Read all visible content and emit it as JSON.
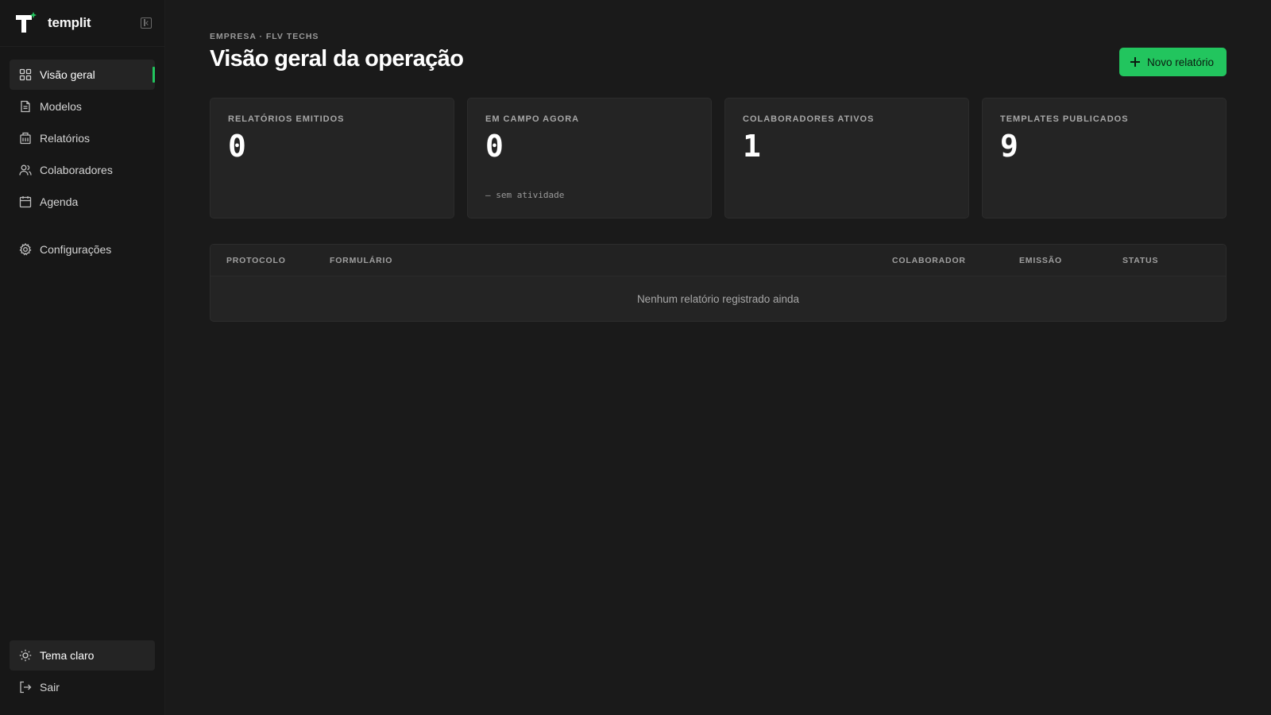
{
  "app": {
    "name": "templit"
  },
  "colors": {
    "accent": "#22c55e",
    "background": "#1a1a1a",
    "sidebar": "#171717",
    "card": "#242424"
  },
  "sidebar": {
    "items": [
      {
        "label": "Visão geral",
        "icon": "grid-icon",
        "active": true
      },
      {
        "label": "Modelos",
        "icon": "file-text-icon"
      },
      {
        "label": "Relatórios",
        "icon": "building-icon"
      },
      {
        "label": "Colaboradores",
        "icon": "users-icon"
      },
      {
        "label": "Agenda",
        "icon": "calendar-icon"
      }
    ],
    "settings": {
      "label": "Configurações",
      "icon": "gear-icon"
    },
    "bottom": {
      "theme": {
        "label": "Tema claro",
        "icon": "sun-icon"
      },
      "logout": {
        "label": "Sair",
        "icon": "logout-icon"
      }
    }
  },
  "header": {
    "breadcrumb": "EMPRESA · FLV TECHS",
    "title": "Visão geral da operação",
    "new_report_label": "Novo relatório"
  },
  "stats": [
    {
      "label": "RELATÓRIOS EMITIDOS",
      "value": "0",
      "sub": ""
    },
    {
      "label": "EM CAMPO AGORA",
      "value": "0",
      "sub": "— sem atividade"
    },
    {
      "label": "COLABORADORES ATIVOS",
      "value": "1",
      "sub": ""
    },
    {
      "label": "TEMPLATES PUBLICADOS",
      "value": "9",
      "sub": ""
    }
  ],
  "table": {
    "columns": [
      "PROTOCOLO",
      "FORMULÁRIO",
      "COLABORADOR",
      "EMISSÃO",
      "STATUS"
    ],
    "empty_message": "Nenhum relatório registrado ainda"
  }
}
